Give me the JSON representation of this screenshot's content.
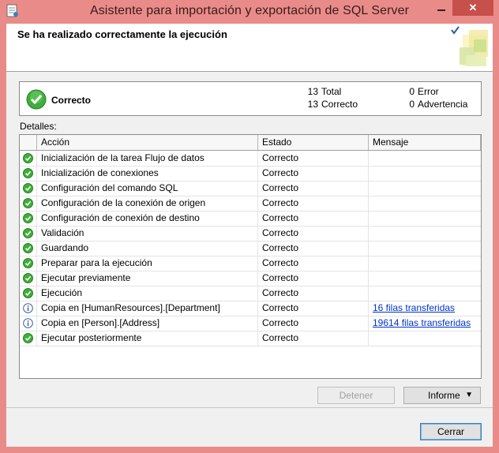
{
  "window": {
    "title": "Asistente para importación y exportación de SQL Server",
    "close_glyph": "✕"
  },
  "header": {
    "title": "Se ha realizado correctamente la ejecución"
  },
  "summary": {
    "status": "Correcto",
    "total_count": "13",
    "total_label": "Total",
    "success_count": "13",
    "success_label": "Correcto",
    "error_count": "0",
    "error_label": "Error",
    "warning_count": "0",
    "warning_label": "Advertencia"
  },
  "details": {
    "label": "Detalles:",
    "columns": [
      "Acción",
      "Estado",
      "Mensaje"
    ],
    "rows": [
      {
        "icon": "success-icon",
        "action": "Inicialización de la tarea Flujo de datos",
        "status": "Correcto",
        "message": ""
      },
      {
        "icon": "success-icon",
        "action": "Inicialización de conexiones",
        "status": "Correcto",
        "message": ""
      },
      {
        "icon": "success-icon",
        "action": "Configuración del comando SQL",
        "status": "Correcto",
        "message": ""
      },
      {
        "icon": "success-icon",
        "action": "Configuración de la conexión de origen",
        "status": "Correcto",
        "message": ""
      },
      {
        "icon": "success-icon",
        "action": "Configuración de conexión de destino",
        "status": "Correcto",
        "message": ""
      },
      {
        "icon": "success-icon",
        "action": "Validación",
        "status": "Correcto",
        "message": ""
      },
      {
        "icon": "success-icon",
        "action": "Guardando",
        "status": "Correcto",
        "message": ""
      },
      {
        "icon": "success-icon",
        "action": "Preparar para la ejecución",
        "status": "Correcto",
        "message": ""
      },
      {
        "icon": "success-icon",
        "action": "Ejecutar previamente",
        "status": "Correcto",
        "message": ""
      },
      {
        "icon": "success-icon",
        "action": "Ejecución",
        "status": "Correcto",
        "message": ""
      },
      {
        "icon": "info-icon",
        "action": "Copia en [HumanResources].[Department]",
        "status": "Correcto",
        "message": "16 filas transferidas"
      },
      {
        "icon": "info-icon",
        "action": "Copia en [Person].[Address]",
        "status": "Correcto",
        "message": "19614 filas transferidas"
      },
      {
        "icon": "success-icon",
        "action": "Ejecutar posteriormente",
        "status": "Correcto",
        "message": ""
      }
    ]
  },
  "buttons": {
    "stop": "Detener",
    "report": "Informe",
    "report_arrow": "▼",
    "close": "Cerrar"
  },
  "colors": {
    "title_bar": "#e98c89",
    "close_button": "#c7504a",
    "success_green": "#3fae3a",
    "link_blue": "#0033cc"
  }
}
